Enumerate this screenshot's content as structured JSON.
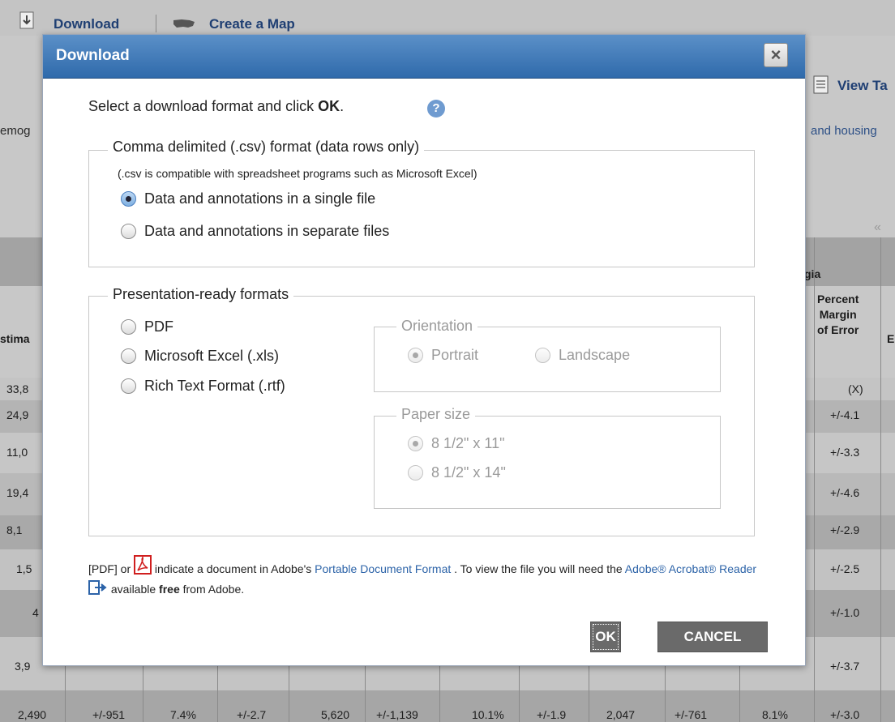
{
  "background": {
    "download_link": "Download",
    "create_map_link": "Create a Map",
    "view_table_link": "View Ta",
    "left_text": "emog",
    "right_text": "and housing",
    "pager": "«",
    "header_fragment_gia": "gia",
    "header_estimate": "stima",
    "header_percent_moe": [
      "Percent",
      "Margin",
      "of Error"
    ],
    "header_e": "E",
    "left_col": [
      "33,8",
      "24,9",
      "11,0",
      "19,4",
      "8,1",
      "1,5",
      "4",
      "3,9"
    ],
    "right_col": [
      "(X)",
      "+/-4.1",
      "+/-3.3",
      "+/-4.6",
      "+/-2.9",
      "+/-2.5",
      "+/-1.0",
      "+/-3.7"
    ],
    "bottom_row": [
      "2,490",
      "+/-951",
      "7.4%",
      "+/-2.7",
      "5,620",
      "+/-1,139",
      "10.1%",
      "+/-1.9",
      "2,047",
      "+/-761",
      "8.1%",
      "+/-3.0"
    ]
  },
  "dialog": {
    "title": "Download",
    "close_label": "×",
    "intro_prefix": "Select a download format and click ",
    "intro_bold": "OK",
    "intro_suffix": ".",
    "help_label": "?",
    "csv": {
      "legend": "Comma delimited (.csv) format (data rows only)",
      "note": "(.csv is compatible with spreadsheet programs such as Microsoft Excel)",
      "options": [
        {
          "label": "Data and annotations in a single file",
          "checked": true
        },
        {
          "label": "Data and annotations in separate files",
          "checked": false
        }
      ]
    },
    "presentation": {
      "legend": "Presentation-ready formats",
      "options": [
        {
          "label": "PDF",
          "checked": false
        },
        {
          "label": "Microsoft Excel (.xls)",
          "checked": false
        },
        {
          "label": "Rich Text Format (.rtf)",
          "checked": false
        }
      ],
      "orientation": {
        "legend": "Orientation",
        "portrait": "Portrait",
        "landscape": "Landscape",
        "selected": "Portrait"
      },
      "paper_size": {
        "legend": "Paper size",
        "letter": "8 1/2\" x 11\"",
        "legal": "8 1/2\" x 14\"",
        "selected": "8 1/2\" x 11\""
      }
    },
    "footer": {
      "pdf_label": "[PDF] or",
      "text1": "indicate a document in Adobe's",
      "pdf_link": "Portable Document Format",
      "text2": ". To view the file you will need the",
      "reader_link": "Adobe® Acrobat® Reader",
      "text3": "available",
      "free": "free",
      "text4": "from Adobe."
    },
    "buttons": {
      "ok": "OK",
      "cancel": "CANCEL"
    }
  }
}
